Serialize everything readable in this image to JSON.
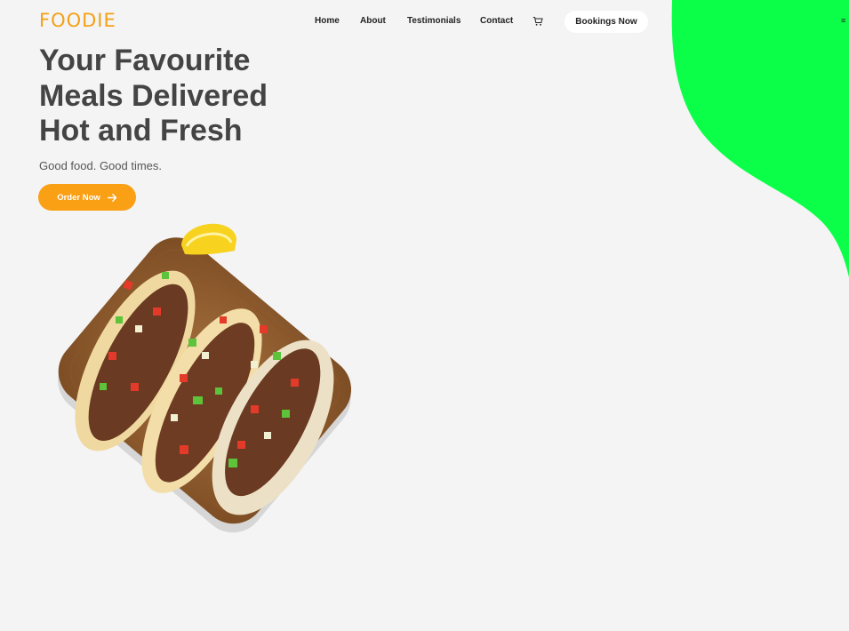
{
  "brand": {
    "logo_text": "FOODIE"
  },
  "nav": {
    "items": [
      "Home",
      "About",
      "Testimonials",
      "Contact"
    ],
    "cart_icon": "cart-icon",
    "booking_button": "Bookings Now",
    "menu_icon": "menu-icon",
    "menu_glyph": "≡"
  },
  "hero": {
    "title": "Your Favourite\nMeals Delivered\nHot and Fresh",
    "tagline": "Good food. Good times.",
    "cta_label": "Order Now",
    "cta_icon": "arrow-right-icon",
    "image": "tacos-on-board-image"
  },
  "colors": {
    "accent": "#f9a015",
    "blob": "#0bff48",
    "background": "#f4f4f4",
    "heading": "#444444"
  }
}
